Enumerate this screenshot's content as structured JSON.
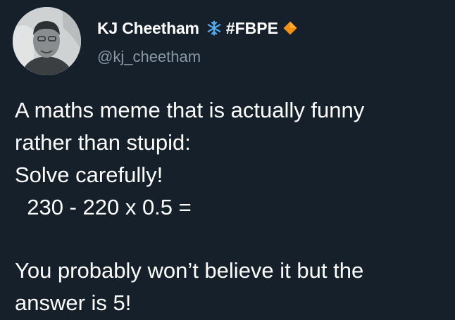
{
  "author": {
    "display_name": "KJ Cheetham",
    "name_tag": "#FBPE",
    "handle": "@kj_cheetham",
    "icons": [
      "snowflake-icon",
      "orange-diamond-icon"
    ]
  },
  "tweet": {
    "lines": [
      "A maths meme that is actually funny",
      "rather than stupid:",
      "Solve carefully!",
      "  230 - 220 x 0.5 =",
      "You probably won’t believe it but the",
      "answer is 5!"
    ]
  },
  "colors": {
    "background": "#15202b",
    "text": "#ffffff",
    "handle": "#8899a6",
    "snowflake": "#55acee",
    "diamond": "#f4900c"
  }
}
